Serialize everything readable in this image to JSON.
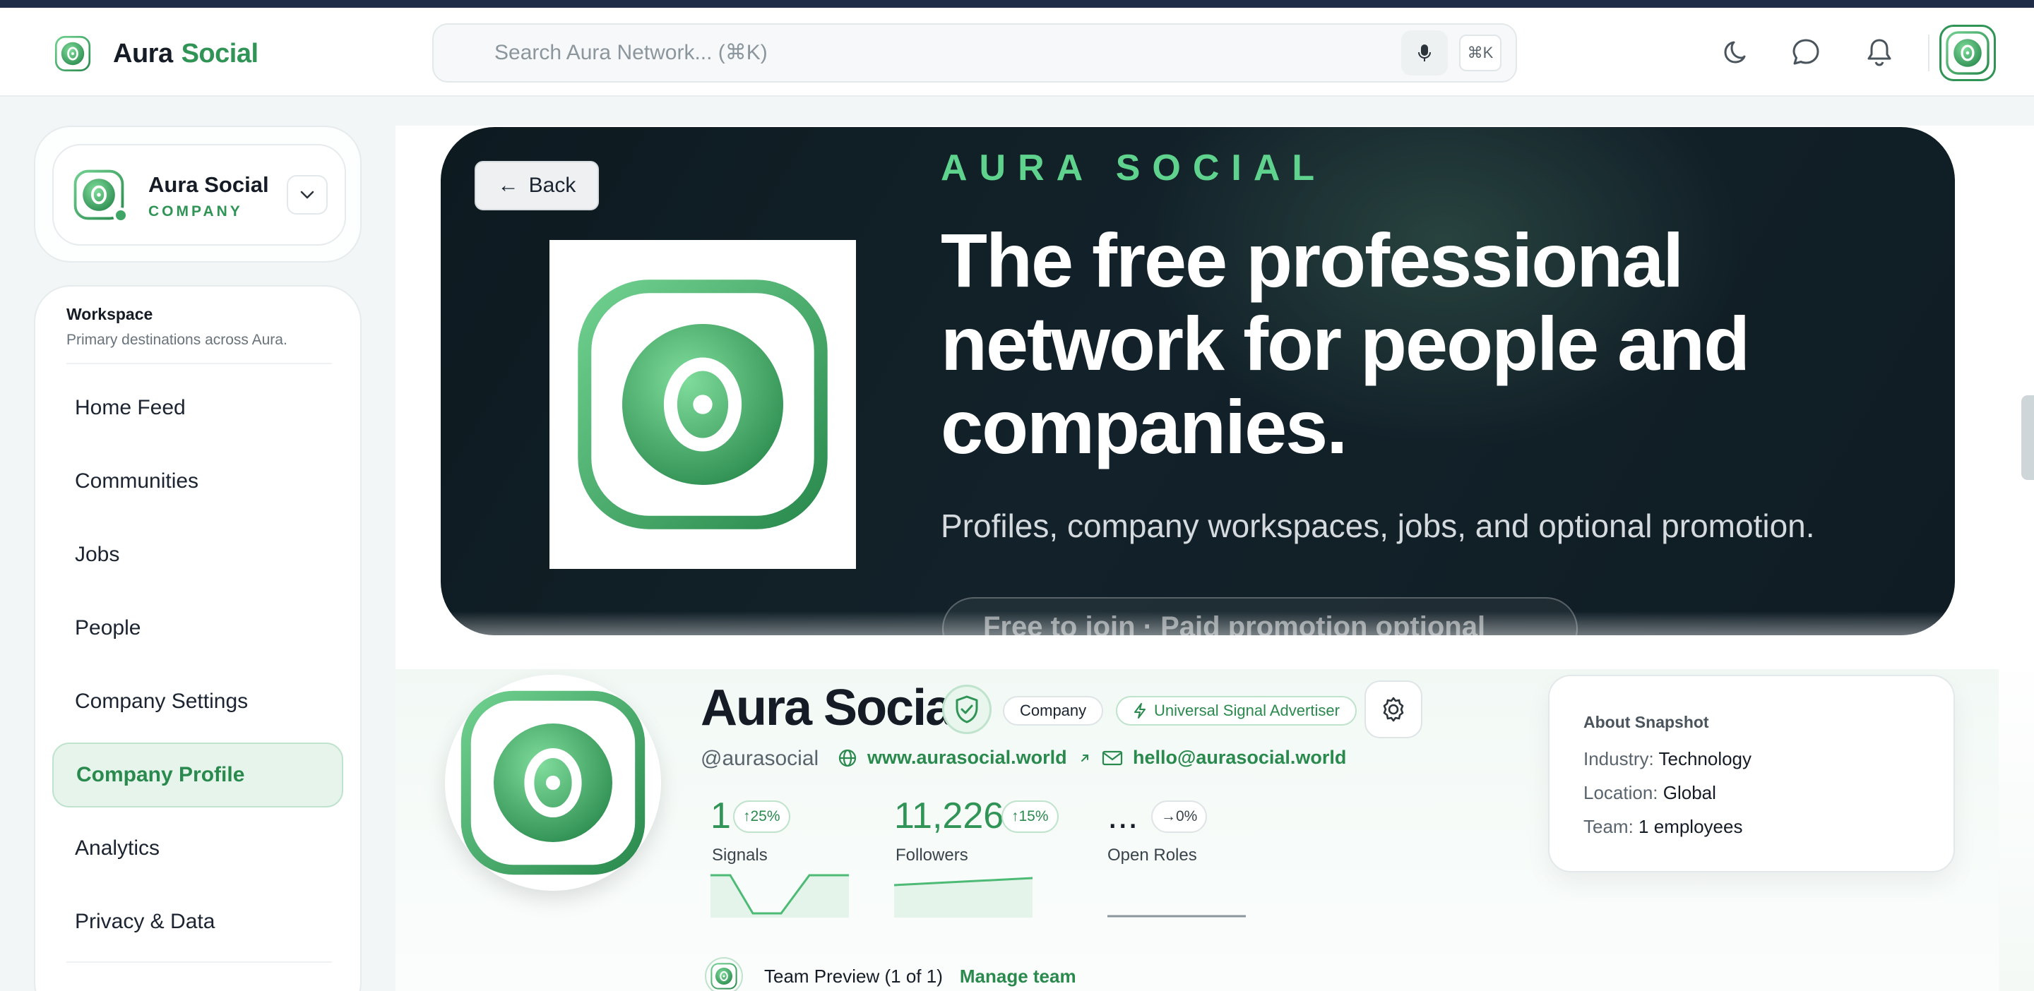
{
  "header": {
    "brand_word1": "Aura",
    "brand_word2": "Social",
    "search_placeholder": "Search Aura Network... (⌘K)",
    "kbd_label": "⌘K",
    "icons": [
      "moon-icon",
      "chat-icon",
      "bell-icon"
    ]
  },
  "org": {
    "name": "Aura Social",
    "type": "COMPANY"
  },
  "nav": {
    "title": "Workspace",
    "subtitle": "Primary destinations across Aura.",
    "items": [
      {
        "label": "Home Feed"
      },
      {
        "label": "Communities"
      },
      {
        "label": "Jobs"
      },
      {
        "label": "People"
      },
      {
        "label": "Company Settings"
      },
      {
        "label": "Company Profile",
        "active": true
      },
      {
        "label": "Analytics"
      },
      {
        "label": "Privacy & Data"
      }
    ]
  },
  "hero": {
    "back_label": "Back",
    "eyebrow": "AURA SOCIAL",
    "title": "The free professional network for people and companies.",
    "subtitle": "Profiles, company workspaces, jobs, and optional promotion.",
    "pill": "Free to join · Paid promotion optional"
  },
  "profile": {
    "name": "Aura Social",
    "chip_company": "Company",
    "chip_advertiser": "Universal Signal Advertiser",
    "handle": "@aurasocial",
    "website": "www.aurasocial.world",
    "email": "hello@aurasocial.world",
    "stats": [
      {
        "value": "1",
        "change": "↑25%",
        "label": "Signals"
      },
      {
        "value": "11,226",
        "change": "↑15%",
        "label": "Followers"
      },
      {
        "value": "...",
        "change": "→0%",
        "label": "Open Roles"
      }
    ]
  },
  "about": {
    "title": "About Snapshot",
    "industry_key": "Industry:",
    "industry_val": "Technology",
    "location_key": "Location:",
    "location_val": "Global",
    "team_key": "Team:",
    "team_val": "1 employees"
  },
  "team": {
    "label": "Team Preview (1 of 1)",
    "link": "Manage team"
  },
  "colors": {
    "accent": "#2f9455",
    "accent_light": "#5fd38e",
    "hero_bg": "#0f1c24",
    "topstrip": "#1f2d47"
  }
}
